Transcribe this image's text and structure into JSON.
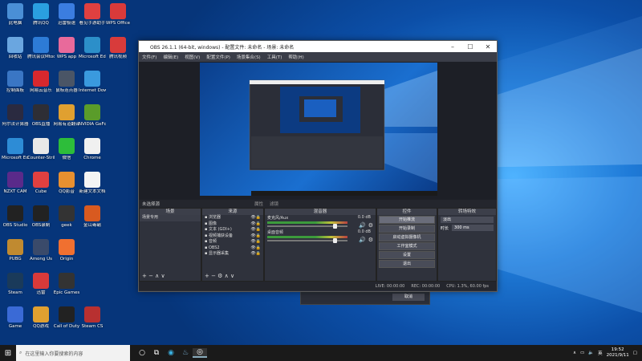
{
  "desktop": {
    "icons": [
      {
        "label": "此电脑",
        "color": "#4a8fd6"
      },
      {
        "label": "腾讯QQ",
        "color": "#2a9fe0"
      },
      {
        "label": "迅雷极速",
        "color": "#3b7de0"
      },
      {
        "label": "看见手游助手",
        "color": "#e04040"
      },
      {
        "label": "WPS Office",
        "color": "#d93a3a"
      },
      {
        "label": "回收站",
        "color": "#6aa6e0"
      },
      {
        "label": "腾讯会议Mtools",
        "color": "#2d7bd6"
      },
      {
        "label": "WPS app",
        "color": "#e86a9b"
      },
      {
        "label": "Microsoft Edge",
        "color": "#2c8fc9"
      },
      {
        "label": "腾讯视频",
        "color": "#d83b3b"
      },
      {
        "label": "控制面板",
        "color": "#3a76c4"
      },
      {
        "label": "网易云音乐",
        "color": "#d8282e"
      },
      {
        "label": "鼠标连点器",
        "color": "#4a5566"
      },
      {
        "label": "Internet Download",
        "color": "#3a9ade"
      },
      {
        "label": "阿尔法计算器",
        "color": "#2a2a40"
      },
      {
        "label": "OBS直播",
        "color": "#2e2e35"
      },
      {
        "label": "网易有道翻译",
        "color": "#e0a030"
      },
      {
        "label": "NVIDIA GeForce",
        "color": "#5a9c2a"
      },
      {
        "label": "Microsoft Edge",
        "color": "#2d8cd6"
      },
      {
        "label": "Counter-Strike",
        "color": "#e8e8e8"
      },
      {
        "label": "微信",
        "color": "#2dbd3a"
      },
      {
        "label": "Chrome",
        "color": "#f0f0f0"
      },
      {
        "label": "NZXT CAM",
        "color": "#5a2a8a"
      },
      {
        "label": "Cube",
        "color": "#e04040"
      },
      {
        "label": "QQ影音",
        "color": "#e89030"
      },
      {
        "label": "新建文本文档",
        "color": "#f4f4f4"
      },
      {
        "label": "OBS Studio",
        "color": "#222"
      },
      {
        "label": "OBS录制",
        "color": "#222"
      },
      {
        "label": "geek",
        "color": "#333"
      },
      {
        "label": "金山毒霸",
        "color": "#d85a20"
      },
      {
        "label": "PUBG",
        "color": "#c08a30"
      },
      {
        "label": "Among Us",
        "color": "#3a4a6a"
      },
      {
        "label": "Origin",
        "color": "#f07030"
      },
      {
        "label": "Steam",
        "color": "#1a3a5a"
      },
      {
        "label": "迅雷",
        "color": "#d83a3a"
      },
      {
        "label": "Epic Games",
        "color": "#333"
      },
      {
        "label": "Game",
        "color": "#3a6ad6"
      },
      {
        "label": "QQ游戏",
        "color": "#e0a030"
      },
      {
        "label": "Call of Duty",
        "color": "#222"
      },
      {
        "label": "Steam CS",
        "color": "#b83030"
      }
    ]
  },
  "obs": {
    "title": "OBS 26.1.1 (64-bit, windows) - 配置文件: 未命名 - 场景: 未命名",
    "menu": [
      "文件(F)",
      "编辑(E)",
      "视图(V)",
      "配置文件(P)",
      "场景集合(S)",
      "工具(T)",
      "帮助(H)"
    ],
    "scene_label": "未选择源",
    "scene_tabs": [
      "属性",
      "滤镜"
    ],
    "docks": {
      "scenes": {
        "title": "场景",
        "items": [
          "场景专用"
        ]
      },
      "sources": {
        "title": "来源",
        "items": [
          "浏览器",
          "图像",
          "文本 (GDI+)",
          "视频捕获设备",
          "音频",
          "OBS2",
          "显示器采集"
        ]
      },
      "mixer": {
        "title": "混音器",
        "rows": [
          {
            "name": "麦克风/Aux",
            "db": "0.0 dB"
          },
          {
            "name": "桌面音频",
            "db": "0.0 dB"
          }
        ]
      },
      "controls": {
        "title": "控件",
        "buttons": [
          "开始推流",
          "开始录制",
          "启动虚拟摄像机",
          "工作室模式",
          "设置",
          "退出"
        ]
      },
      "transitions": {
        "title": "转场特效",
        "type": "淡出",
        "duration_label": "时长",
        "duration": "300 ms"
      }
    },
    "status": {
      "live": "LIVE: 00:00:00",
      "rec": "REC: 00:00:00",
      "cpu": "CPU: 1.3%, 60.00 fps"
    },
    "behind_button": "取消"
  },
  "taskbar": {
    "search_placeholder": "在这里输入你要搜索的内容",
    "time": "19:52",
    "date": "2021/9/11",
    "ime": "英"
  }
}
